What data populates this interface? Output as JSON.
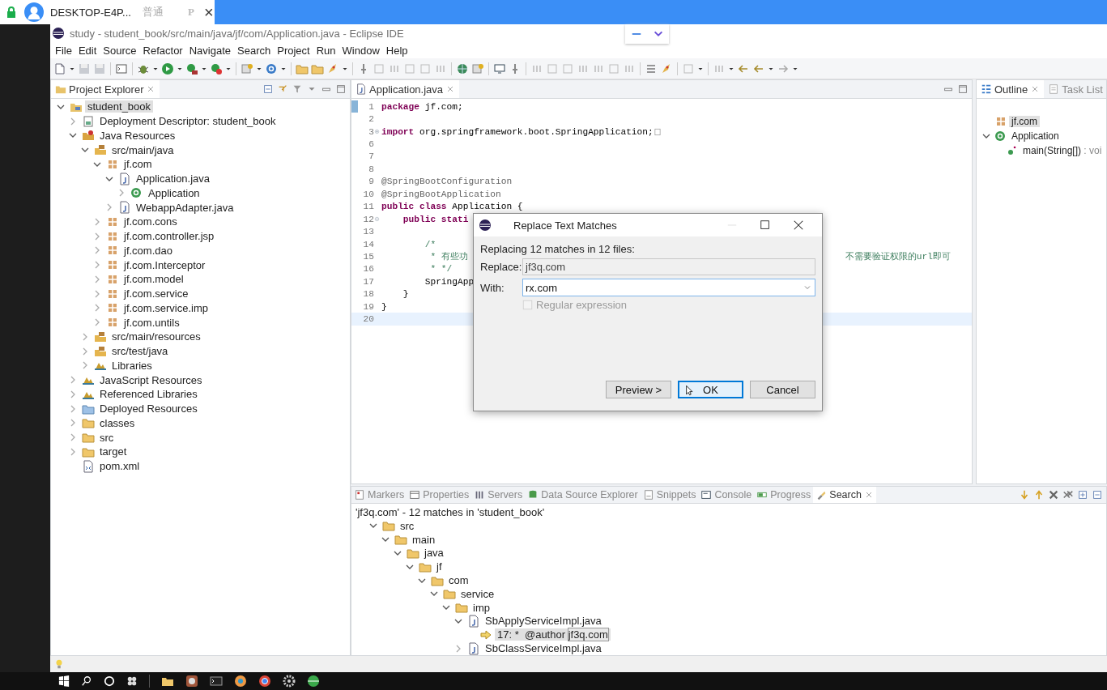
{
  "remote_bar": {
    "host": "DESKTOP-E4P...",
    "mode": "普通",
    "badge": "P",
    "close": "×"
  },
  "window": {
    "title": "study - student_book/src/main/java/jf/com/Application.java - Eclipse IDE"
  },
  "menu": [
    "File",
    "Edit",
    "Source",
    "Refactor",
    "Navigate",
    "Search",
    "Project",
    "Run",
    "Window",
    "Help"
  ],
  "project_explorer": {
    "title": "Project Explorer",
    "tree": [
      {
        "label": "student_book",
        "kind": "project",
        "expanded": true,
        "selected": true,
        "children": [
          {
            "label": "Deployment Descriptor: student_book",
            "kind": "descriptor",
            "expanded": false,
            "selected": false
          },
          {
            "label": "Java Resources",
            "kind": "javares",
            "expanded": true,
            "selected": false,
            "children": [
              {
                "label": "src/main/java",
                "kind": "srcfolder",
                "expanded": true,
                "selected": false,
                "children": [
                  {
                    "label": "jf.com",
                    "kind": "package",
                    "expanded": true,
                    "selected": false,
                    "children": [
                      {
                        "label": "Application.java",
                        "kind": "javafile",
                        "expanded": true,
                        "selected": false,
                        "children": [
                          {
                            "label": "Application",
                            "kind": "class",
                            "expanded": false,
                            "selected": false
                          }
                        ]
                      },
                      {
                        "label": "WebappAdapter.java",
                        "kind": "javafile",
                        "expanded": false,
                        "selected": false
                      }
                    ]
                  },
                  {
                    "label": "jf.com.cons",
                    "kind": "package",
                    "expanded": false,
                    "selected": false
                  },
                  {
                    "label": "jf.com.controller.jsp",
                    "kind": "package",
                    "expanded": false,
                    "selected": false
                  },
                  {
                    "label": "jf.com.dao",
                    "kind": "package",
                    "expanded": false,
                    "selected": false
                  },
                  {
                    "label": "jf.com.Interceptor",
                    "kind": "package",
                    "expanded": false,
                    "selected": false
                  },
                  {
                    "label": "jf.com.model",
                    "kind": "package",
                    "expanded": false,
                    "selected": false
                  },
                  {
                    "label": "jf.com.service",
                    "kind": "package",
                    "expanded": false,
                    "selected": false
                  },
                  {
                    "label": "jf.com.service.imp",
                    "kind": "package",
                    "expanded": false,
                    "selected": false
                  },
                  {
                    "label": "jf.com.untils",
                    "kind": "package",
                    "expanded": false,
                    "selected": false
                  }
                ]
              },
              {
                "label": "src/main/resources",
                "kind": "srcfolder",
                "expanded": false,
                "selected": false
              },
              {
                "label": "src/test/java",
                "kind": "srcfolder",
                "expanded": false,
                "selected": false
              },
              {
                "label": "Libraries",
                "kind": "library",
                "expanded": false,
                "selected": false
              }
            ]
          },
          {
            "label": "JavaScript Resources",
            "kind": "library",
            "expanded": false,
            "selected": false
          },
          {
            "label": "Referenced Libraries",
            "kind": "library",
            "expanded": false,
            "selected": false
          },
          {
            "label": "Deployed Resources",
            "kind": "deployed",
            "expanded": false,
            "selected": false
          },
          {
            "label": "classes",
            "kind": "folder",
            "expanded": false,
            "selected": false
          },
          {
            "label": "src",
            "kind": "folder",
            "expanded": false,
            "selected": false
          },
          {
            "label": "target",
            "kind": "folder",
            "expanded": false,
            "selected": false
          },
          {
            "label": "pom.xml",
            "kind": "xml",
            "selected": false
          }
        ]
      }
    ]
  },
  "editor": {
    "tab": {
      "label": "Application.java",
      "selected": true
    },
    "lines": [
      {
        "number": "1",
        "current": false,
        "segments": [
          {
            "kind": "keyword",
            "text": "package"
          },
          {
            "kind": "plain",
            "text": " jf.com;"
          }
        ]
      },
      {
        "number": "2",
        "current": false
      },
      {
        "number": "3",
        "current": false,
        "folded": true,
        "segments": [
          {
            "kind": "keyword",
            "text": "import"
          },
          {
            "kind": "plain",
            "text": " org.springframework.boot.SpringApplication;"
          }
        ]
      },
      {
        "number": "6",
        "current": false
      },
      {
        "number": "7",
        "current": false
      },
      {
        "number": "8",
        "current": false
      },
      {
        "number": "9",
        "current": false,
        "segments": [
          {
            "kind": "annotation",
            "text": "@SpringBootConfiguration"
          }
        ]
      },
      {
        "number": "10",
        "current": false,
        "segments": [
          {
            "kind": "annotation",
            "text": "@SpringBootApplication"
          }
        ]
      },
      {
        "number": "11",
        "current": false,
        "segments": [
          {
            "kind": "keyword",
            "text": "public class"
          },
          {
            "kind": "plain",
            "text": " Application {"
          }
        ]
      },
      {
        "number": "12",
        "current": false,
        "folded": false,
        "segments": [
          {
            "kind": "keyword",
            "text": "    public stati"
          }
        ]
      },
      {
        "number": "13",
        "current": false
      },
      {
        "number": "14",
        "current": false,
        "segments": [
          {
            "kind": "comment",
            "text": "        /*"
          }
        ]
      },
      {
        "number": "15",
        "current": false,
        "segments": [
          {
            "kind": "comment",
            "text": "         * 有些功"
          }
        ],
        "segments_right": [
          {
            "kind": "comment",
            "text": "不需要验证权限的url即可"
          }
        ]
      },
      {
        "number": "16",
        "current": false,
        "segments": [
          {
            "kind": "comment",
            "text": "         * */"
          }
        ]
      },
      {
        "number": "17",
        "current": false,
        "segments": [
          {
            "kind": "plain",
            "text": "        SpringApp"
          }
        ]
      },
      {
        "number": "18",
        "current": false,
        "segments": [
          {
            "kind": "plain",
            "text": "    }"
          }
        ]
      },
      {
        "number": "19",
        "current": false,
        "segments": [
          {
            "kind": "plain",
            "text": "}"
          }
        ]
      },
      {
        "number": "20",
        "current": true
      }
    ]
  },
  "outline": {
    "tabs": [
      {
        "label": "Outline",
        "selected": true
      },
      {
        "label": "Task List",
        "selected": false
      }
    ],
    "tree": [
      {
        "label": "jf.com",
        "kind": "package",
        "selected": true
      },
      {
        "label": "Application",
        "kind": "class",
        "expanded": true,
        "selected": false,
        "children": [
          {
            "label": "main(String[])",
            "type": ": voi",
            "kind": "method",
            "selected": false
          }
        ]
      }
    ]
  },
  "search_view": {
    "tabs": [
      {
        "label": "Markers",
        "selected": false
      },
      {
        "label": "Properties",
        "selected": false
      },
      {
        "label": "Servers",
        "selected": false
      },
      {
        "label": "Data Source Explorer",
        "selected": false
      },
      {
        "label": "Snippets",
        "selected": false
      },
      {
        "label": "Console",
        "selected": false
      },
      {
        "label": "Progress",
        "selected": false
      },
      {
        "label": "Search",
        "selected": true
      }
    ],
    "summary": "'jf3q.com' - 12 matches in 'student_book'",
    "tree": [
      {
        "label": "src",
        "kind": "folder",
        "expanded": true,
        "selected": false,
        "children": [
          {
            "label": "main",
            "kind": "folder",
            "expanded": true,
            "selected": false,
            "children": [
              {
                "label": "java",
                "kind": "folder",
                "expanded": true,
                "selected": false,
                "children": [
                  {
                    "label": "jf",
                    "kind": "folder",
                    "expanded": true,
                    "selected": false,
                    "children": [
                      {
                        "label": "com",
                        "kind": "folder",
                        "expanded": true,
                        "selected": false,
                        "children": [
                          {
                            "label": "service",
                            "kind": "folder",
                            "expanded": true,
                            "selected": false,
                            "children": [
                              {
                                "label": "imp",
                                "kind": "folder",
                                "expanded": true,
                                "selected": false,
                                "children": [
                                  {
                                    "label": "SbApplyServiceImpl.java",
                                    "kind": "javafile",
                                    "expanded": true,
                                    "selected": false,
                                    "children": [
                                      {
                                        "label": "17: *  @author ",
                                        "match": "jf3q.com",
                                        "kind": "match",
                                        "selected": true
                                      }
                                    ]
                                  },
                                  {
                                    "label": "SbClassServiceImpl.java",
                                    "kind": "javafile",
                                    "expanded": false,
                                    "selected": false
                                  }
                                ]
                              }
                            ]
                          }
                        ]
                      }
                    ]
                  }
                ]
              }
            ]
          }
        ]
      }
    ]
  },
  "dialog": {
    "title": "Replace Text Matches",
    "message": "Replacing 12 matches in 12 files:",
    "replace_label": "Replace:",
    "replace_value": "jf3q.com",
    "with_label": "With:",
    "with_value": "rx.com",
    "regex": {
      "label": "Regular expression",
      "checked": false,
      "disabled": true
    },
    "buttons": [
      {
        "label": "Preview >",
        "default": false
      },
      {
        "label": "OK",
        "default": true
      },
      {
        "label": "Cancel",
        "default": false
      }
    ]
  }
}
